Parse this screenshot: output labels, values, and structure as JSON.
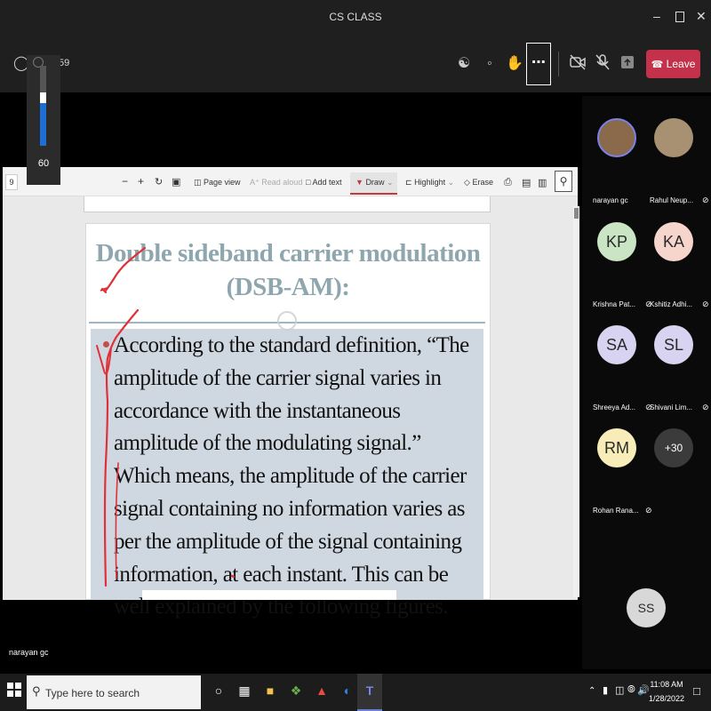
{
  "window": {
    "title": "CS CLASS"
  },
  "toolbar": {
    "timer": "59",
    "more_label": "⋯",
    "leave_label": "Leave",
    "leave_color": "#c4314b"
  },
  "volume": {
    "value": "60",
    "level": 0.6
  },
  "pdf_toolbar": {
    "page_number": "9",
    "page_view": "Page view",
    "read_aloud": "Read aloud",
    "add_text": "Add text",
    "draw": "Draw",
    "highlight": "Highlight",
    "erase": "Erase"
  },
  "slide": {
    "title": "Double sideband carrier modulation (DSB-AM):",
    "body": "According to the standard definition, “The amplitude of the carrier signal varies in accordance with the instantaneous amplitude of the modulating signal.” Which means, the amplitude of the carrier signal containing no information varies as per the amplitude of the signal containing information, at each instant. This can be well explained by the following figures."
  },
  "presenter": {
    "name": "narayan gc"
  },
  "participants": [
    {
      "initials": "",
      "name": "narayan gc",
      "mic_off": false,
      "color": "#8a6a4a"
    },
    {
      "initials": "",
      "name": "Rahul Neup...",
      "mic_off": true,
      "color": "#a89072"
    },
    {
      "initials": "KP",
      "name": "Krishna Pat...",
      "mic_off": true,
      "color": "#c9e5c3"
    },
    {
      "initials": "KA",
      "name": "Kshitiz Adhi...",
      "mic_off": true,
      "color": "#f6d6cc"
    },
    {
      "initials": "SA",
      "name": "Shreeya Ad...",
      "mic_off": true,
      "color": "#d8d3f0"
    },
    {
      "initials": "SL",
      "name": "Shivani Lim...",
      "mic_off": true,
      "color": "#d8d3f0"
    },
    {
      "initials": "RM",
      "name": "Rohan Rana...",
      "mic_off": true,
      "color": "#f8edb8"
    },
    {
      "initials": "+30",
      "name": "",
      "mic_off": false,
      "color": "#3b3b3b"
    }
  ],
  "self_view": {
    "initials": "SS"
  },
  "taskbar": {
    "search_placeholder": "Type here to search",
    "time": "11:08 AM",
    "date": "1/28/2022"
  },
  "icons": [
    "windows-icon",
    "search-icon",
    "cortana-icon",
    "task-view-icon",
    "file-explorer-icon",
    "store-icon",
    "app-icon",
    "edge-icon",
    "teams-icon",
    "shield-icon",
    "people-icon",
    "chat-icon",
    "reactions-icon",
    "camera-off-icon",
    "mic-off-icon",
    "share-icon",
    "phone-icon",
    "pen-icon",
    "chevron-up-icon",
    "network-icon",
    "volume-icon",
    "notifications-icon"
  ]
}
